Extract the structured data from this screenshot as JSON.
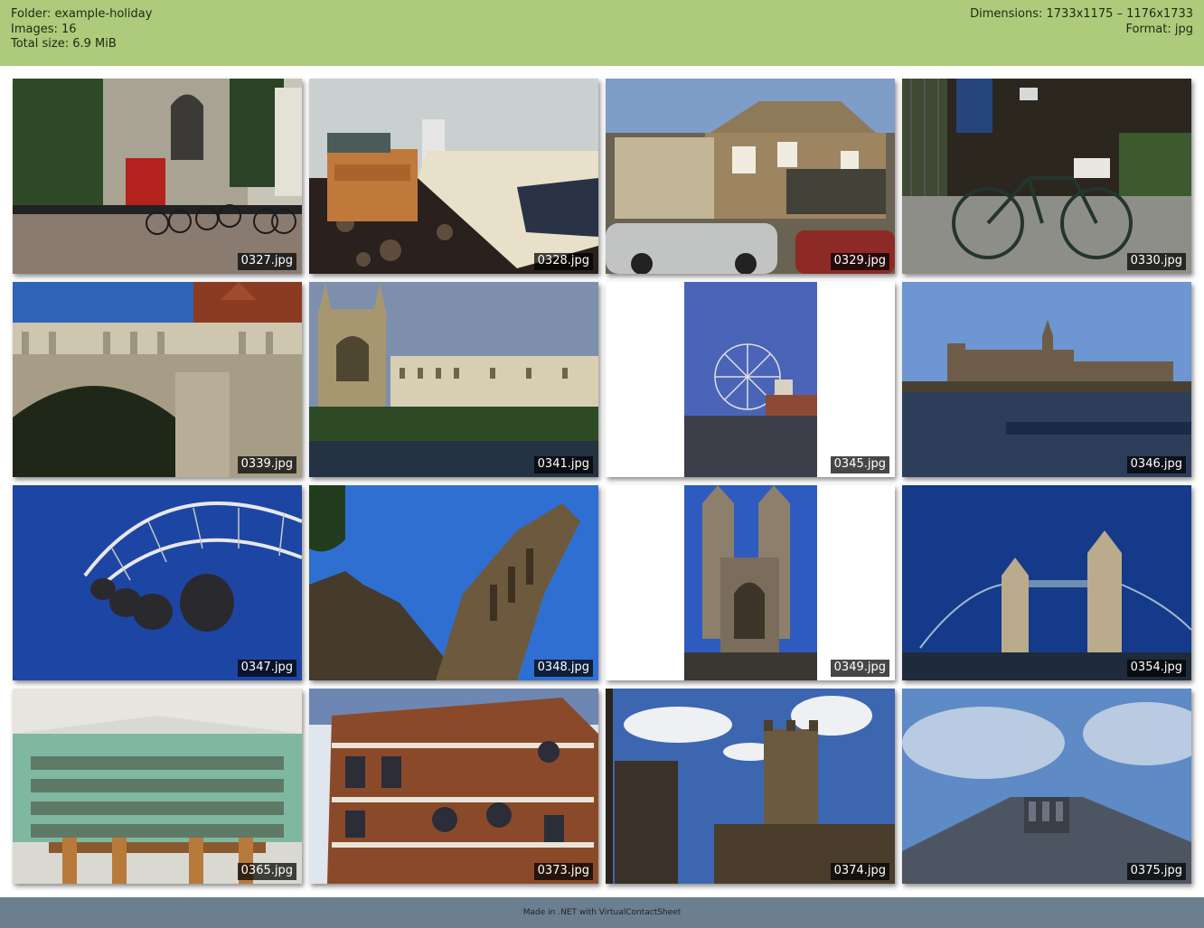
{
  "header": {
    "folder": "Folder: example-holiday",
    "images": "Images: 16",
    "total_size": "Total size: 6.9 MiB",
    "dimensions": "Dimensions: 1733x1175 – 1176x1733",
    "format": "Format: jpg"
  },
  "photos": [
    {
      "file": "0327.jpg",
      "orientation": "landscape",
      "scene": "church-with-bicycles"
    },
    {
      "file": "0328.jpg",
      "orientation": "landscape",
      "scene": "bedroom"
    },
    {
      "file": "0329.jpg",
      "orientation": "landscape",
      "scene": "brick-house-with-cars"
    },
    {
      "file": "0330.jpg",
      "orientation": "landscape",
      "scene": "bicycle-by-fence"
    },
    {
      "file": "0339.jpg",
      "orientation": "landscape",
      "scene": "stone-bridge"
    },
    {
      "file": "0341.jpg",
      "orientation": "landscape",
      "scene": "college-by-river"
    },
    {
      "file": "0345.jpg",
      "orientation": "portrait",
      "scene": "ferris-wheel"
    },
    {
      "file": "0346.jpg",
      "orientation": "landscape",
      "scene": "parliament-river"
    },
    {
      "file": "0347.jpg",
      "orientation": "landscape",
      "scene": "wheel-capsules"
    },
    {
      "file": "0348.jpg",
      "orientation": "landscape",
      "scene": "gothic-tower"
    },
    {
      "file": "0349.jpg",
      "orientation": "portrait",
      "scene": "abbey-towers"
    },
    {
      "file": "0354.jpg",
      "orientation": "landscape",
      "scene": "tower-bridge"
    },
    {
      "file": "0365.jpg",
      "orientation": "landscape",
      "scene": "library-interior"
    },
    {
      "file": "0373.jpg",
      "orientation": "landscape",
      "scene": "red-brick-building"
    },
    {
      "file": "0374.jpg",
      "orientation": "landscape",
      "scene": "church-tower-clouds"
    },
    {
      "file": "0375.jpg",
      "orientation": "landscape",
      "scene": "tower-looking-up"
    }
  ],
  "footer": {
    "credit": "Made in .NET with VirtualContactSheet"
  },
  "colors": {
    "header_bg": "#aecb7c",
    "footer_bg": "#6c7f8f",
    "label_bg": "#000000"
  }
}
